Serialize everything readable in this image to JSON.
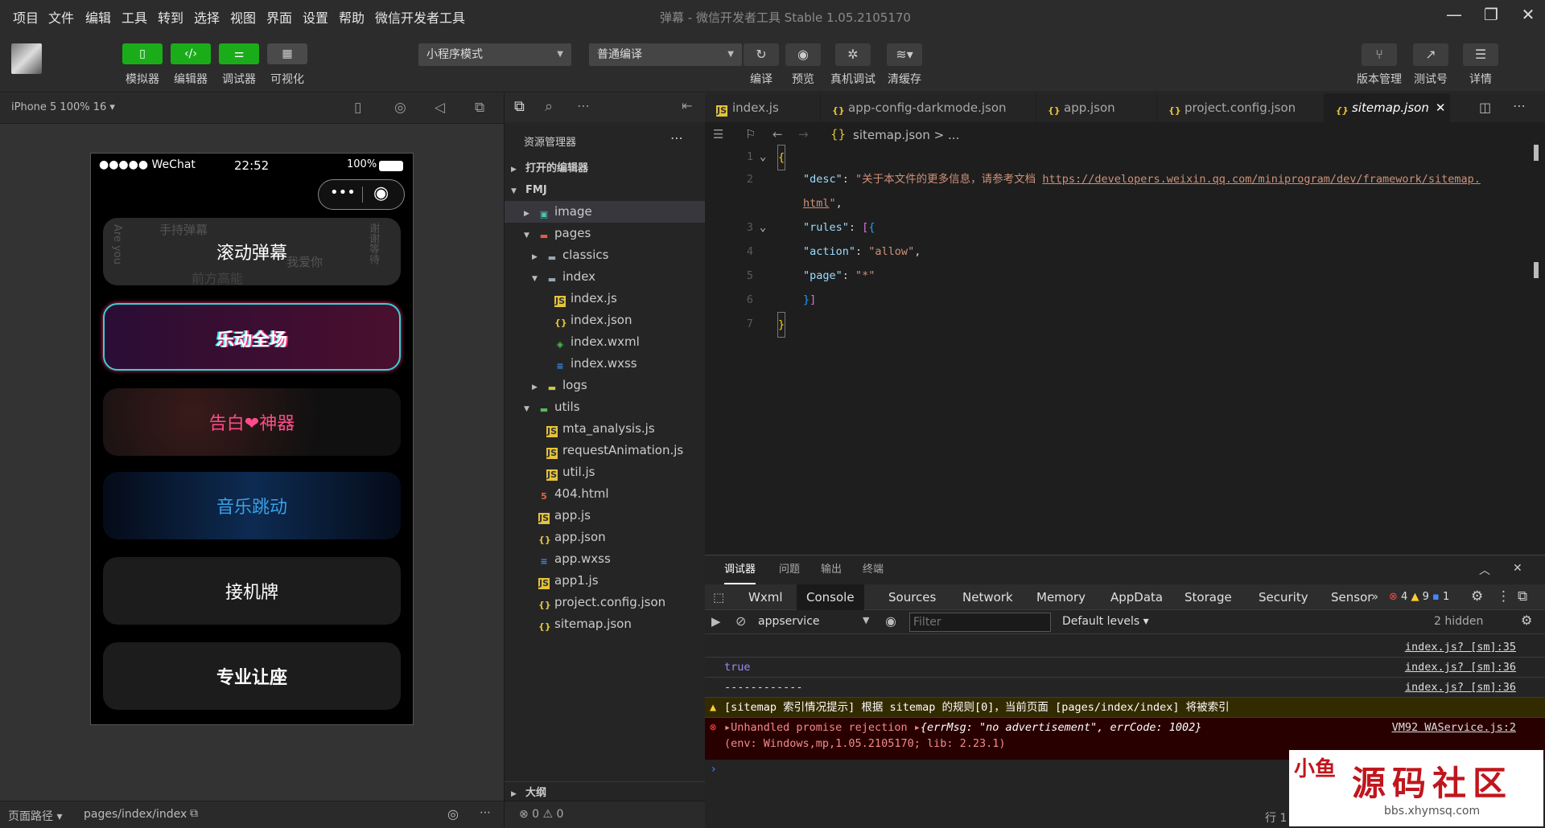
{
  "menu": {
    "items": [
      "项目",
      "文件",
      "编辑",
      "工具",
      "转到",
      "选择",
      "视图",
      "界面",
      "设置",
      "帮助",
      "微信开发者工具"
    ]
  },
  "window": {
    "title": "弹幕 - 微信开发者工具 Stable 1.05.2105170"
  },
  "toolbar": {
    "simulator": "模拟器",
    "editor": "编辑器",
    "debugger": "调试器",
    "visual": "可视化",
    "mode": "小程序模式",
    "compile_mode": "普通编译",
    "compile": "编译",
    "preview": "预览",
    "remote_debug": "真机调试",
    "clear_cache": "清缓存",
    "version": "版本管理",
    "test_account": "测试号",
    "details": "详情"
  },
  "simulator": {
    "device": "iPhone 5 100% 16 ▾",
    "status_carrier": "●●●●● WeChat",
    "status_time": "22:52",
    "status_battery": "100%",
    "cards": [
      {
        "title": "滚动弹幕"
      },
      {
        "title": "乐动全场"
      },
      {
        "title": "告白❤神器"
      },
      {
        "title": "音乐跳动"
      },
      {
        "title": "接机牌"
      },
      {
        "title": "专业让座"
      }
    ],
    "bg_words": [
      "手持弹幕",
      "我爱你",
      "前方高能",
      "谢谢等待",
      "Are you"
    ]
  },
  "path_bar": {
    "label": "页面路径 ▾",
    "path": "pages/index/index"
  },
  "explorer": {
    "title": "资源管理器",
    "open_editors": "打开的编辑器",
    "project": "FMJ",
    "outline": "大纲",
    "problems": "⊗ 0 ⚠ 0",
    "tree": [
      {
        "name": "image",
        "type": "folder-img"
      },
      {
        "name": "pages",
        "type": "folder-red"
      },
      {
        "name": "classics",
        "type": "folder"
      },
      {
        "name": "index",
        "type": "folder"
      },
      {
        "name": "index.js",
        "type": "js"
      },
      {
        "name": "index.json",
        "type": "json"
      },
      {
        "name": "index.wxml",
        "type": "wxml"
      },
      {
        "name": "index.wxss",
        "type": "wxss"
      },
      {
        "name": "logs",
        "type": "folder-yellow"
      },
      {
        "name": "utils",
        "type": "folder-green"
      },
      {
        "name": "mta_analysis.js",
        "type": "js"
      },
      {
        "name": "requestAnimation.js",
        "type": "js"
      },
      {
        "name": "util.js",
        "type": "js"
      },
      {
        "name": "404.html",
        "type": "html"
      },
      {
        "name": "app.js",
        "type": "js"
      },
      {
        "name": "app.json",
        "type": "json"
      },
      {
        "name": "app.wxss",
        "type": "wxss"
      },
      {
        "name": "app1.js",
        "type": "js"
      },
      {
        "name": "project.config.json",
        "type": "json"
      },
      {
        "name": "sitemap.json",
        "type": "json"
      }
    ]
  },
  "editor": {
    "tabs": [
      "index.js",
      "app-config-darkmode.json",
      "app.json",
      "project.config.json",
      "sitemap.json"
    ],
    "breadcrumb": "sitemap.json > ...",
    "lines": {
      "n1": "1",
      "n2": "2",
      "n3": "3",
      "n4": "4",
      "n5": "5",
      "n6": "6",
      "n7": "7",
      "desc_key": "\"desc\"",
      "desc_val": "\"关于本文件的更多信息，请参考文档 ",
      "desc_url": "https://developers.weixin.qq.com/miniprogram/dev/framework/sitemap.",
      "desc_url2": "html",
      "rules_key": "\"rules\"",
      "action_key": "\"action\"",
      "action_val": "\"allow\"",
      "page_key": "\"page\"",
      "page_val": "\"*\""
    }
  },
  "devtools": {
    "top_tabs": [
      "调试器",
      "问题",
      "输出",
      "终端"
    ],
    "panels": [
      "Wxml",
      "Console",
      "Sources",
      "Network",
      "Memory",
      "AppData",
      "Storage",
      "Security",
      "Sensor"
    ],
    "counts": {
      "errors": "4",
      "warnings": "9",
      "info": "1"
    },
    "context": "appservice",
    "filter_placeholder": "Filter",
    "levels": "Default levels ▾",
    "hidden": "2 hidden",
    "logs": [
      {
        "text": "",
        "src": "index.js? [sm]:35"
      },
      {
        "text": "true",
        "src": "index.js? [sm]:36"
      },
      {
        "text": "------------",
        "src": "index.js? [sm]:36"
      }
    ],
    "warning": "[sitemap 索引情况提示] 根据 sitemap 的规则[0]，当前页面 [pages/index/index] 将被索引",
    "error_line1": "Unhandled promise rejection ",
    "error_obj": "{errMsg: \"no advertisement\", errCode: 1002}",
    "error_src": "VM92 WAService.js:2",
    "error_line2": "(env: Windows,mp,1.05.2105170; lib: 2.23.1)",
    "row_col": "行 1"
  },
  "watermark": {
    "title": "源码社区",
    "url": "bbs.xhymsq.com",
    "logo_text": "小鱼"
  }
}
